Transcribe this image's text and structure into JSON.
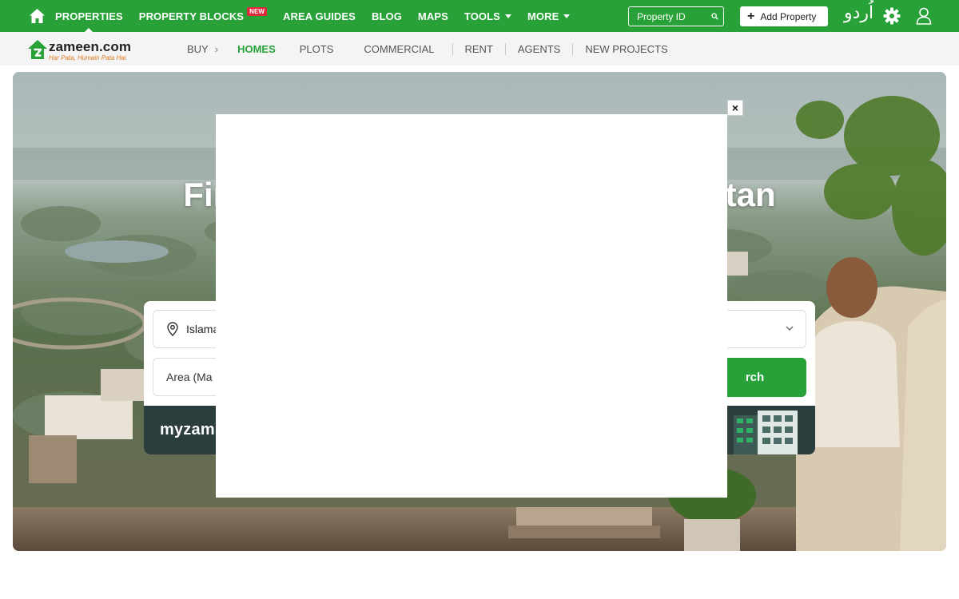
{
  "topnav": {
    "items": [
      {
        "label": "PROPERTIES",
        "active": true
      },
      {
        "label": "PROPERTY BLOCKS",
        "badge": "NEW"
      },
      {
        "label": "AREA GUIDES"
      },
      {
        "label": "BLOG"
      },
      {
        "label": "MAPS"
      },
      {
        "label": "TOOLS",
        "dropdown": true
      },
      {
        "label": "MORE",
        "dropdown": true
      }
    ],
    "property_id_placeholder": "Property ID",
    "add_property": "Add Property",
    "urdu_label": "اُردو",
    "brand_color": "#28a138",
    "badge_color": "#e0283c"
  },
  "logo": {
    "name": "zameen.com",
    "tagline": "Har Pata, Humain Pata Hai"
  },
  "subnav": {
    "buy": "BUY",
    "homes": "HOMES",
    "plots": "PLOTS",
    "commercial": "COMMERCIAL",
    "rent": "RENT",
    "agents": "AGENTS",
    "new_projects": "NEW PROJECTS"
  },
  "hero": {
    "title_left": "Fin",
    "title_right": "stan",
    "city_value": "Islama",
    "area_placeholder": "Area (Ma",
    "search_label": "rch",
    "banner_brand": "myzam"
  },
  "modal": {
    "close_label": "×"
  }
}
